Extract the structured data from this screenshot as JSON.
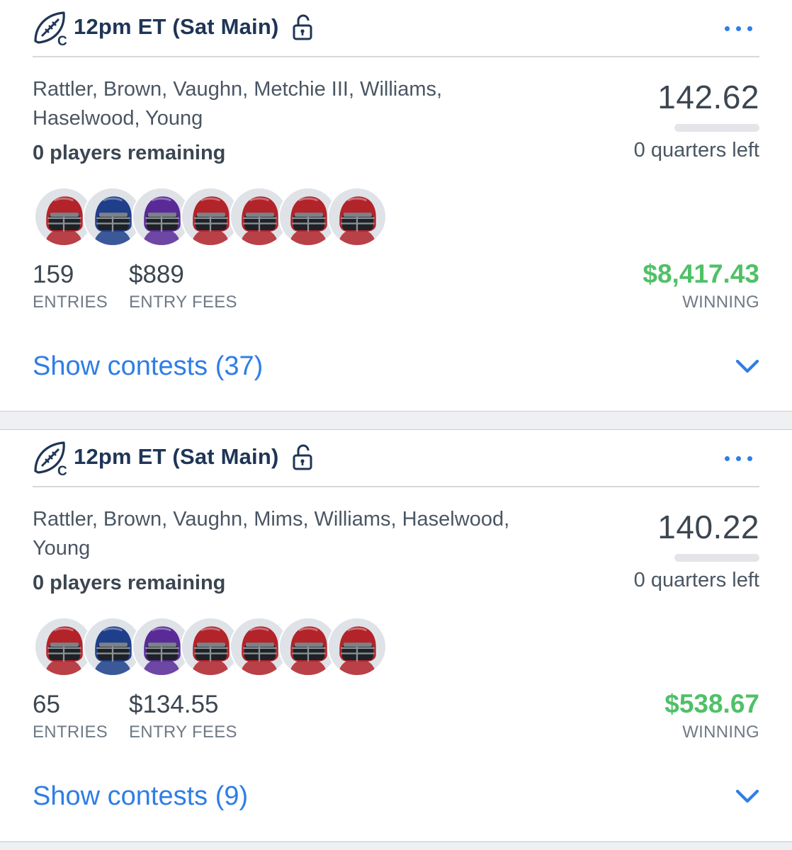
{
  "colors": {
    "accent": "#2e7ee6",
    "title": "#1f3556",
    "winning": "#4fc167",
    "helmets": [
      "#b3232a",
      "#1f3f8a",
      "#5a2a97",
      "#b3232a",
      "#b3232a",
      "#b3232a",
      "#b3232a"
    ]
  },
  "icons": {
    "slate": "football-c-icon",
    "lock": "lock-icon",
    "more": "more-dots-icon",
    "expand": "chevron-down-icon",
    "player": "helmet-icon"
  },
  "lineups": [
    {
      "slate_title": "12pm ET (Sat Main)",
      "players": "Rattler, Brown, Vaughn, Metchie III, Williams, Haselwood, Young",
      "remaining": "0 players remaining",
      "score": "142.62",
      "progress": 0.0,
      "quarters_left": "0 quarters left",
      "entries": "159",
      "entries_label": "ENTRIES",
      "entry_fees": "$889",
      "entry_fees_label": "ENTRY FEES",
      "winning": "$8,417.43",
      "winning_label": "WINNING",
      "show_contests": "Show contests (37)"
    },
    {
      "slate_title": "12pm ET (Sat Main)",
      "players": "Rattler, Brown, Vaughn, Mims, Williams, Haselwood, Young",
      "remaining": "0 players remaining",
      "score": "140.22",
      "progress": 0.0,
      "quarters_left": "0 quarters left",
      "entries": "65",
      "entries_label": "ENTRIES",
      "entry_fees": "$134.55",
      "entry_fees_label": "ENTRY FEES",
      "winning": "$538.67",
      "winning_label": "WINNING",
      "show_contests": "Show contests (9)"
    }
  ]
}
